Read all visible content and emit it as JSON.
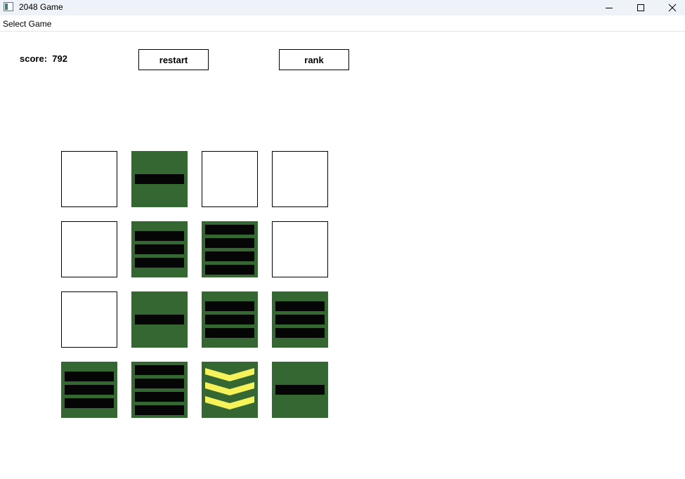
{
  "window": {
    "title": "2048 Game",
    "app_icon": "app-window-icon",
    "controls": [
      "minimize-icon",
      "maximize-icon",
      "close-icon"
    ]
  },
  "menu": {
    "items": [
      "Select Game"
    ]
  },
  "score_text": "score:  792",
  "buttons": {
    "restart": "restart",
    "rank": "rank"
  },
  "colors": {
    "tile_filled": "#356733",
    "bar": "#050505",
    "chevron": "#f5f25a",
    "empty_border": "#000000"
  },
  "board": [
    [
      "empty",
      "bars-1",
      "empty",
      "empty"
    ],
    [
      "empty",
      "bars-3",
      "bars-4",
      "empty"
    ],
    [
      "empty",
      "bars-1",
      "bars-3",
      "bars-3"
    ],
    [
      "bars-3",
      "bars-4",
      "chevrons-3",
      "bars-1"
    ]
  ]
}
